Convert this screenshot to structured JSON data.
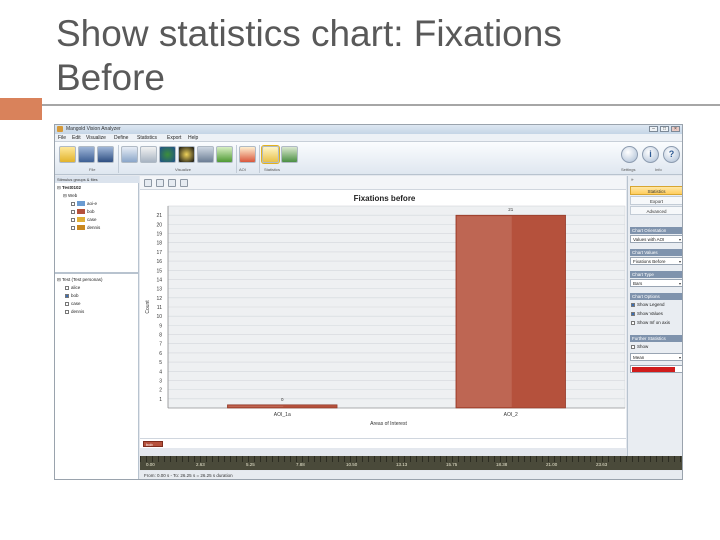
{
  "slide": {
    "title": "Show statistics chart: Fixations Before"
  },
  "window": {
    "app_name": "Mangold Vision Analyzer",
    "minimize": "–",
    "maximize": "□",
    "close": "×"
  },
  "menu": [
    "File",
    "Edit",
    "Visualize",
    "Define",
    "Statistics",
    "Export",
    "Help"
  ],
  "ribbon": {
    "groups": [
      "File",
      "Visualize",
      "AOI",
      "Statistics",
      "Settings",
      "Info"
    ],
    "info_label": "i",
    "help_label": "?"
  },
  "left_panel": {
    "header": "Stimulus groups & files",
    "root": "Test0102",
    "folder": "Web",
    "items": [
      {
        "label": "aoi-e",
        "color": "#6b9bd1"
      },
      {
        "label": "bob",
        "color": "#b5513c"
      },
      {
        "label": "case",
        "color": "#e0b038"
      },
      {
        "label": "dennis",
        "color": "#c8871e"
      }
    ],
    "participants_header": "Test (Test personas)",
    "participants": [
      {
        "label": "alice",
        "checked": false
      },
      {
        "label": "bob",
        "checked": true
      },
      {
        "label": "case",
        "checked": false
      },
      {
        "label": "dennis",
        "checked": false
      }
    ]
  },
  "right_panel": {
    "top_label": "»",
    "tabs": [
      "Statistics",
      "Export",
      "Advanced"
    ],
    "active_tab": "Statistics",
    "sections": {
      "orientation": {
        "title": "Chart Orientation",
        "value": "Values with AOI"
      },
      "values": {
        "title": "Chart Values",
        "value": "Fixations Before"
      },
      "type": {
        "title": "Chart Type",
        "value": "Bars"
      },
      "options": {
        "title": "Chart Options",
        "items": [
          {
            "label": "Show Legend",
            "checked": true
          },
          {
            "label": "Show Values",
            "checked": true
          },
          {
            "label": "Show Inf on axis",
            "checked": false
          }
        ]
      },
      "further": {
        "title": "Further Statistics",
        "show_label": "Show",
        "value": "Mean"
      }
    },
    "bar_color": "#d01c1c"
  },
  "legend": {
    "label": "bob"
  },
  "timeline": {
    "labels": [
      "0.00",
      "2.63",
      "5.25",
      "7.88",
      "10.50",
      "13.13",
      "15.75",
      "18.38",
      "21.00",
      "23.63"
    ]
  },
  "statusbar": {
    "text": "From: 0.00 s - To: 26.25 s  =  26.25 s duration"
  },
  "chart_data": {
    "type": "bar",
    "title": "Fixations before",
    "xlabel": "Areas of Interest",
    "ylabel": "Count",
    "categories": [
      "AOI_1a",
      "AOI_2"
    ],
    "series": [
      {
        "name": "bob",
        "values": [
          0,
          21
        ]
      }
    ],
    "data_labels": [
      "0",
      "21"
    ],
    "ylim": [
      0,
      22
    ],
    "yticks": [
      1,
      2,
      3,
      4,
      5,
      6,
      7,
      8,
      9,
      10,
      11,
      12,
      13,
      14,
      15,
      16,
      17,
      18,
      19,
      20,
      21
    ],
    "grid": true,
    "colors": [
      "#b5513c"
    ]
  }
}
